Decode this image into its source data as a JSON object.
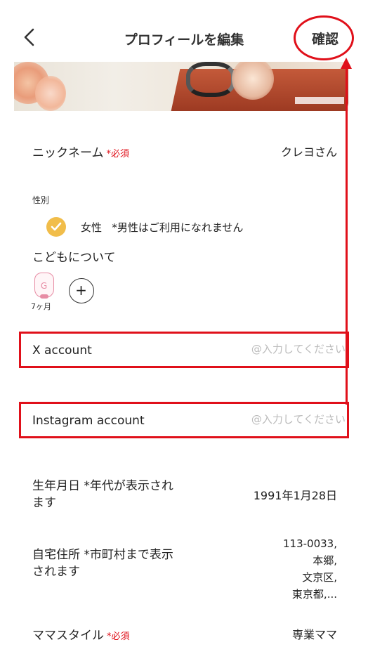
{
  "header": {
    "title": "プロフィールを編集",
    "confirm_label": "確認"
  },
  "fields": {
    "nickname": {
      "label": "ニックネーム",
      "required": "*必須",
      "value": "クレヨさん"
    },
    "gender": {
      "label": "性別",
      "option": "女性",
      "note": "*男性はご利用になれません"
    },
    "children": {
      "title": "こどもについて",
      "avatar_letter": "G",
      "age": "7ヶ月"
    },
    "x_account": {
      "label": "X account",
      "placeholder": "@入力してください"
    },
    "instagram_account": {
      "label": "Instagram account",
      "placeholder": "@入力してください"
    },
    "birthdate": {
      "label": "生年月日 *年代が表示されます",
      "value": "1991年1月28日"
    },
    "address": {
      "label": "自宅住所 *市町村まで表示されます",
      "lines": [
        "113-0033,",
        "本郷,",
        "文京区,",
        "東京都,..."
      ]
    },
    "mama_style": {
      "label": "ママスタイル",
      "required": "*必須",
      "value": "専業ママ"
    }
  },
  "colors": {
    "required": "#e0101a",
    "check": "#f1bd4a",
    "annotation": "#e0101a",
    "child_accent": "#e78ca4"
  }
}
